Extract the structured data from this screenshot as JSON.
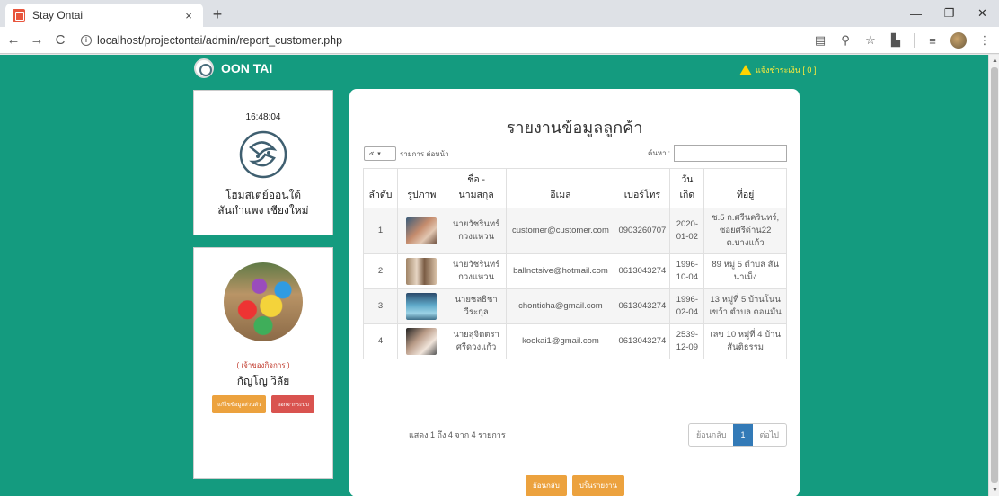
{
  "browser": {
    "tab_title": "Stay Ontai",
    "tab_close": "×",
    "new_tab": "+",
    "url": "localhost/projectontai/admin/report_customer.php",
    "back": "←",
    "forward": "→",
    "reload": "C",
    "minimize": "—",
    "restore": "❐",
    "close": "✕"
  },
  "header": {
    "brand": "OON TAI",
    "alert_text": "แจ้งชำระเงิน [ 0 ]"
  },
  "sidebar": {
    "clock": "16:48:04",
    "hotel_name_line1": "โฮมสเตย์ออนใต้",
    "hotel_name_line2": "สันกำแพง เชียงใหม่",
    "user_role": "( เจ้าของกิจการ )",
    "user_name": "กัญโญ วิลัย",
    "edit_button": "แก้ไขข้อมูลส่วนตัว",
    "logout_button": "ออกจากระบบ"
  },
  "report": {
    "title": "รายงานข้อมูลลูกค้า",
    "length_value": "๕",
    "length_label": "รายการ ต่อหน้า",
    "search_label": "ค้นหา :",
    "search_value": "",
    "columns": [
      "ลำดับ",
      "รูปภาพ",
      "ชื่อ - นามสกุล",
      "อีเมล",
      "เบอร์โทร",
      "วันเกิด",
      "ที่อยู่"
    ],
    "rows": [
      {
        "no": "1",
        "name": "นายวัชรินทร์ กวงแหวน",
        "email": "customer@customer.com",
        "phone": "0903260707",
        "birth": "2020-01-02",
        "address": "ช.5 ถ.ศรีนครินทร์, ซอยศรีด่าน22 ต.บางแก้ว"
      },
      {
        "no": "2",
        "name": "นายวัชรินทร์ กวงแหวน",
        "email": "ballnotsive@hotmail.com",
        "phone": "0613043274",
        "birth": "1996-10-04",
        "address": "89 หมู่ 5 ตำบล สันนาเม็ง"
      },
      {
        "no": "3",
        "name": "นายชลธิชา วีระกุล",
        "email": "chonticha@gmail.com",
        "phone": "0613043274",
        "birth": "1996-02-04",
        "address": "13 หมู่ที่ 5 บ้านโนนเขว้า ตำบล ดอนมัน"
      },
      {
        "no": "4",
        "name": "นายสุจิตตรา ศรีดวงแก้ว",
        "email": "kookai1@gmail.com",
        "phone": "0613043274",
        "birth": "2539-12-09",
        "address": "เลข 10 หมู่ที่ 4 บ้านสันติธรรม"
      }
    ],
    "info": "แสดง 1 ถึง 4 จาก 4 รายการ",
    "prev": "ย้อนกลับ",
    "page": "1",
    "next": "ต่อไป",
    "back_button": "ย้อนกลับ",
    "print_button": "ปริ้นรายงาน"
  }
}
